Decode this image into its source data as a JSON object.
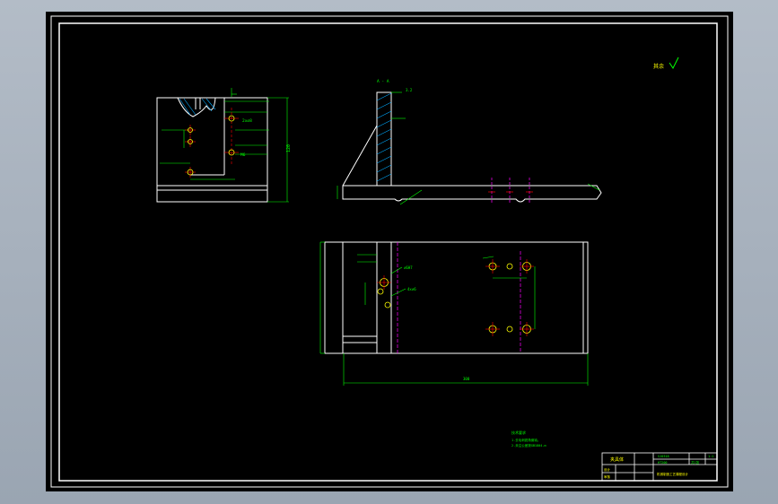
{
  "drawing": {
    "section_label": "A - A",
    "roughness_note": "其余",
    "tech_req_title": "技术要求",
    "tech_req_1": "1.去毛刺锐角倒钝。",
    "tech_req_2": "2.未注公差按GB1804-m",
    "dim_bottom": "300",
    "dim_left": "120",
    "dim_ra": "3.2",
    "hole_label_1": "2x∅8",
    "hole_label_2": "∅6H7",
    "hole_label_3": "4x∅6",
    "hole_label_4": "M6"
  },
  "title_block": {
    "name": "夹具体",
    "drawing_no": "SJ0318",
    "scale": "1:1",
    "material": "HT200",
    "sheet": "共1张",
    "designer": "设计",
    "checker": "审核",
    "company": "机械制造工艺课程设计"
  },
  "colors": {
    "background": "#000000",
    "frame": "#ffffff",
    "dim": "#00ff00",
    "center": "#ff00ff",
    "hole": "#ff0000",
    "note": "#ffff00"
  }
}
